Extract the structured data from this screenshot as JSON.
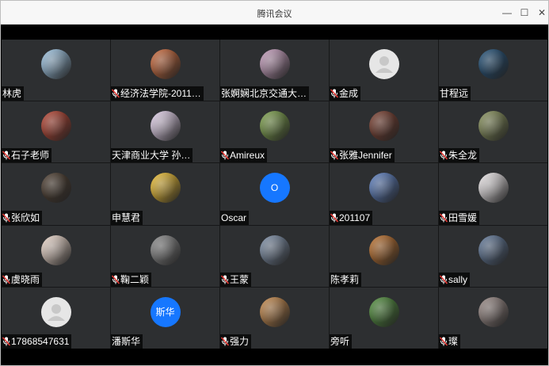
{
  "window": {
    "title": "腾讯会议",
    "minimize_glyph": "—",
    "maximize_glyph": "☐",
    "close_glyph": "✕"
  },
  "participants": [
    {
      "name": "林虎",
      "mic_muted": false,
      "avatar": "photo-airplane",
      "color": "#9fc7e6"
    },
    {
      "name": "经济法学院-2011…",
      "mic_muted": true,
      "avatar": "photo-window",
      "color": "#d06a3a"
    },
    {
      "name": "张婀娴北京交通大…",
      "mic_muted": false,
      "avatar": "photo-sunset",
      "color": "#c9a0c0"
    },
    {
      "name": "金成",
      "mic_muted": true,
      "avatar": "default-person",
      "color": "#e6e6e6"
    },
    {
      "name": "甘程远",
      "mic_muted": false,
      "avatar": "photo-blue",
      "color": "#1f4f78"
    },
    {
      "name": "石子老师",
      "mic_muted": true,
      "avatar": "photo-group",
      "color": "#b9412e"
    },
    {
      "name": "天津商业大学 孙…",
      "mic_muted": false,
      "avatar": "photo-anime",
      "color": "#e8d6f0"
    },
    {
      "name": "Amireux",
      "mic_muted": true,
      "avatar": "photo-panda",
      "color": "#7ea34a"
    },
    {
      "name": "张雅Jennifer",
      "mic_muted": true,
      "avatar": "photo-crowd",
      "color": "#7a3c2c"
    },
    {
      "name": "朱全龙",
      "mic_muted": true,
      "avatar": "photo-horse",
      "color": "#88925a"
    },
    {
      "name": "张欣如",
      "mic_muted": true,
      "avatar": "photo-girl",
      "color": "#4a3a2c"
    },
    {
      "name": "申慧君",
      "mic_muted": false,
      "avatar": "photo-cartoon",
      "color": "#f2c230"
    },
    {
      "name": "Oscar",
      "mic_muted": false,
      "avatar": "initial",
      "avatar_text": "O",
      "color": "#1677ff"
    },
    {
      "name": "201107",
      "mic_muted": true,
      "avatar": "photo-tree",
      "color": "#5b7fc2"
    },
    {
      "name": "田雪媛",
      "mic_muted": true,
      "avatar": "photo-sticker",
      "color": "#f3eef0"
    },
    {
      "name": "虞晓雨",
      "mic_muted": true,
      "avatar": "photo-doll",
      "color": "#f1dccf"
    },
    {
      "name": "鞠二颖",
      "mic_muted": true,
      "avatar": "photo-cat",
      "color": "#8b8b8b"
    },
    {
      "name": "王蒙",
      "mic_muted": true,
      "avatar": "photo-sea",
      "color": "#7d8fa8"
    },
    {
      "name": "陈孝莉",
      "mic_muted": false,
      "avatar": "photo-art",
      "color": "#c0702a"
    },
    {
      "name": "sally",
      "mic_muted": true,
      "avatar": "photo-sparkle",
      "color": "#60789a"
    },
    {
      "name": "17868547631",
      "mic_muted": true,
      "avatar": "default-person",
      "color": "#e6e6e6"
    },
    {
      "name": "潘斯华",
      "mic_muted": false,
      "avatar": "initial",
      "avatar_text": "斯华",
      "color": "#1677ff"
    },
    {
      "name": "强力",
      "mic_muted": true,
      "avatar": "photo-dusk",
      "color": "#c98a4a"
    },
    {
      "name": "旁听",
      "mic_muted": false,
      "avatar": "photo-plant",
      "color": "#4f8f3a"
    },
    {
      "name": "璨",
      "mic_muted": true,
      "avatar": "photo-kitten",
      "color": "#9a8a86"
    }
  ]
}
